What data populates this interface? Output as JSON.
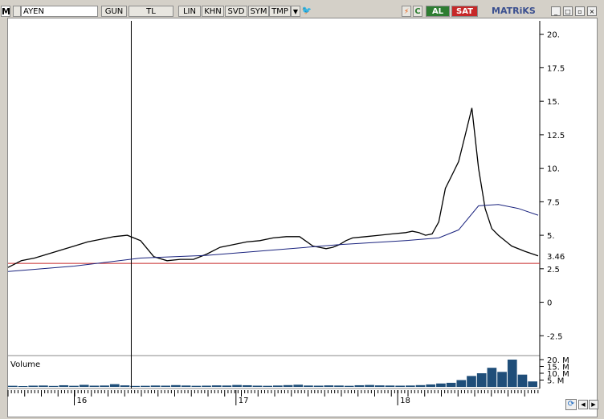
{
  "toolbar": {
    "m_label": "M",
    "symbol": "AYEN",
    "buttons": [
      "GUN",
      "TL",
      "LIN",
      "KHN",
      "SVD",
      "SYM",
      "TMP"
    ],
    "buy_label": "AL",
    "sell_label": "SAT",
    "brand": "MATRiKS"
  },
  "volume_label": "Volume",
  "colors": {
    "price": "#000000",
    "ma": "#1a237e",
    "ref_line": "#c62828",
    "volume": "#1f4e79"
  },
  "chart_data": {
    "type": "line",
    "y_ticks": [
      "20.",
      "17.5",
      "15.",
      "12.5",
      "10.",
      "7.5",
      "5.",
      "2.5",
      "0",
      "-2.5"
    ],
    "ylim": [
      -3.8,
      21
    ],
    "x_ticks": [
      "16",
      "17",
      "18"
    ],
    "last_value_label": "3.46",
    "ref_value": 2.9,
    "crosshair_x": 0.93,
    "series": [
      {
        "x": [
          0,
          0.1,
          0.2,
          0.3,
          0.4,
          0.5,
          0.6,
          0.7,
          0.8,
          0.9,
          1.0,
          1.05,
          1.1,
          1.2,
          1.3,
          1.4,
          1.5,
          1.6,
          1.7,
          1.8,
          1.9,
          2.0,
          2.1,
          2.2,
          2.3,
          2.35,
          2.4,
          2.45,
          2.5,
          2.55,
          2.6,
          2.7,
          2.8,
          2.9,
          3.0,
          3.05,
          3.1,
          3.15,
          3.2,
          3.25,
          3.3,
          3.35,
          3.4,
          3.45,
          3.5,
          3.55,
          3.6,
          3.65,
          3.7,
          3.8,
          3.9,
          4.0
        ],
        "values": [
          2.6,
          3.1,
          3.3,
          3.6,
          3.9,
          4.2,
          4.5,
          4.7,
          4.9,
          5.0,
          4.6,
          4.0,
          3.4,
          3.1,
          3.2,
          3.2,
          3.6,
          4.1,
          4.3,
          4.5,
          4.6,
          4.8,
          4.9,
          4.9,
          4.2,
          4.1,
          4.0,
          4.1,
          4.3,
          4.6,
          4.8,
          4.9,
          5.0,
          5.1,
          5.2,
          5.3,
          5.2,
          5.0,
          5.1,
          6.0,
          8.5,
          9.5,
          10.5,
          12.5,
          14.5,
          10.0,
          7.0,
          5.5,
          5.0,
          4.2,
          3.8,
          3.46
        ],
        "name": ""
      },
      {
        "x": [
          0,
          0.5,
          1.0,
          1.5,
          2.0,
          2.5,
          3.0,
          3.25,
          3.4,
          3.55,
          3.7,
          3.85,
          4.0
        ],
        "values": [
          2.3,
          2.7,
          3.3,
          3.5,
          3.9,
          4.3,
          4.6,
          4.8,
          5.4,
          7.2,
          7.3,
          7.0,
          6.5
        ],
        "name": ""
      }
    ],
    "volume": {
      "ticks": [
        "20. M",
        "15. M",
        "10. M",
        "5. M"
      ],
      "max": 20,
      "values": [
        0.8,
        0.6,
        0.9,
        1.0,
        0.7,
        1.2,
        0.8,
        1.5,
        0.9,
        1.0,
        2.0,
        1.1,
        0.7,
        0.8,
        1.0,
        0.9,
        1.3,
        1.0,
        0.8,
        0.9,
        1.1,
        1.0,
        1.4,
        1.2,
        0.9,
        0.8,
        1.0,
        1.3,
        1.6,
        1.0,
        0.9,
        1.1,
        1.0,
        0.8,
        1.2,
        1.4,
        1.1,
        1.0,
        0.9,
        1.0,
        1.3,
        1.8,
        2.5,
        3.0,
        5.0,
        8.0,
        10.0,
        14.0,
        11.0,
        20.0,
        9.0,
        4.0
      ]
    }
  }
}
